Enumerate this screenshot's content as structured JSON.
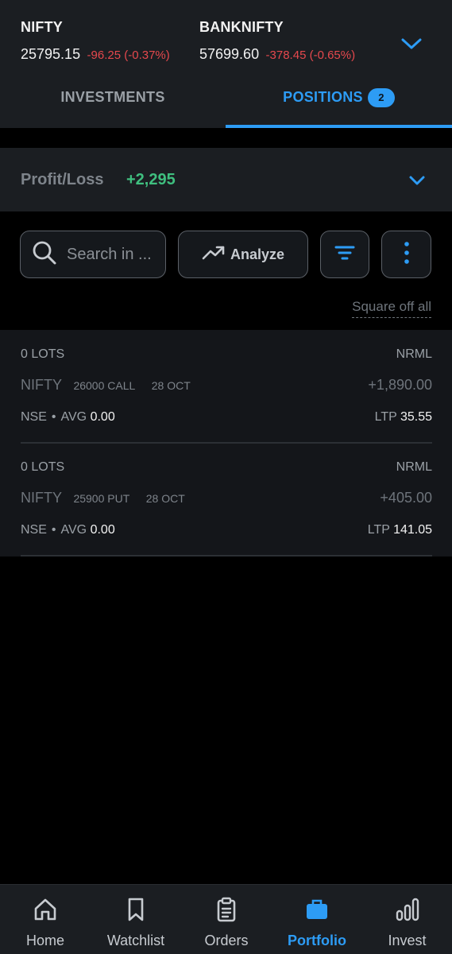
{
  "indices": [
    {
      "name": "NIFTY",
      "price": "25795.15",
      "change": "-96.25 (-0.37%)"
    },
    {
      "name": "BANKNIFTY",
      "price": "57699.60",
      "change": "-378.45 (-0.65%)"
    }
  ],
  "tabs": {
    "investments": "INVESTMENTS",
    "positions": "POSITIONS",
    "positions_count": "2"
  },
  "pnl": {
    "label": "Profit/Loss",
    "value": "+2,295"
  },
  "toolbar": {
    "search_placeholder": "Search in ...",
    "analyze_label": "Analyze"
  },
  "square_off_label": "Square off all",
  "positions": [
    {
      "lots": "0 LOTS",
      "product": "NRML",
      "symbol": "NIFTY",
      "strike": "26000 CALL",
      "expiry": "28 OCT",
      "pnl": "+1,890.00",
      "exchange": "NSE",
      "dot": "•",
      "avg_label": "AVG",
      "avg": "0.00",
      "ltp_label": "LTP",
      "ltp": "35.55"
    },
    {
      "lots": "0 LOTS",
      "product": "NRML",
      "symbol": "NIFTY",
      "strike": "25900 PUT",
      "expiry": "28 OCT",
      "pnl": "+405.00",
      "exchange": "NSE",
      "dot": "•",
      "avg_label": "AVG",
      "avg": "0.00",
      "ltp_label": "LTP",
      "ltp": "141.05"
    }
  ],
  "nav": {
    "items": [
      {
        "label": "Home",
        "icon": "home-icon"
      },
      {
        "label": "Watchlist",
        "icon": "bookmark-icon"
      },
      {
        "label": "Orders",
        "icon": "clipboard-icon"
      },
      {
        "label": "Portfolio",
        "icon": "briefcase-icon",
        "active": true
      },
      {
        "label": "Invest",
        "icon": "bar-chart-icon"
      }
    ]
  },
  "colors": {
    "accent": "#2d9cf5",
    "positive": "#3fbf7f",
    "negative": "#e5484d",
    "header_bg": "#1b1e22"
  }
}
